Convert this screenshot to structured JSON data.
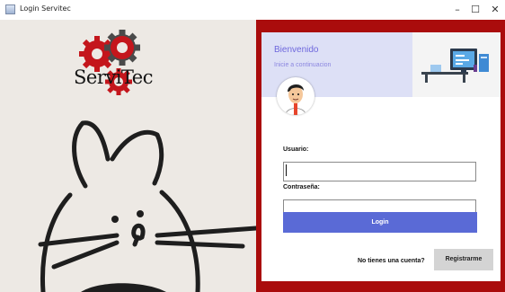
{
  "window": {
    "title": "Login Servitec",
    "minimize_symbol": "–",
    "maximize_symbol": "☐",
    "close_symbol": "✕"
  },
  "logo": {
    "text": "ServiTec",
    "gear_color": "#c4161c",
    "gear_dark_color": "#4a4a4a"
  },
  "colors": {
    "frame": "#aa0c0c",
    "header_bg": "#dde0f6",
    "accent": "#5a6ad6",
    "welcome": "#6e67dd"
  },
  "header": {
    "welcome": "Bienvenido",
    "subtitle": "Inicie a continuacion",
    "illustration_icon": "computer-desk-icon"
  },
  "avatar_icon": "user-avatar-icon",
  "form": {
    "username_label": "Usuario:",
    "username_value": "",
    "password_label": "Contraseña:",
    "password_value": "",
    "login_label": "Login"
  },
  "footer": {
    "no_account": "No tienes una cuenta?",
    "register_label": "Registrarme"
  }
}
